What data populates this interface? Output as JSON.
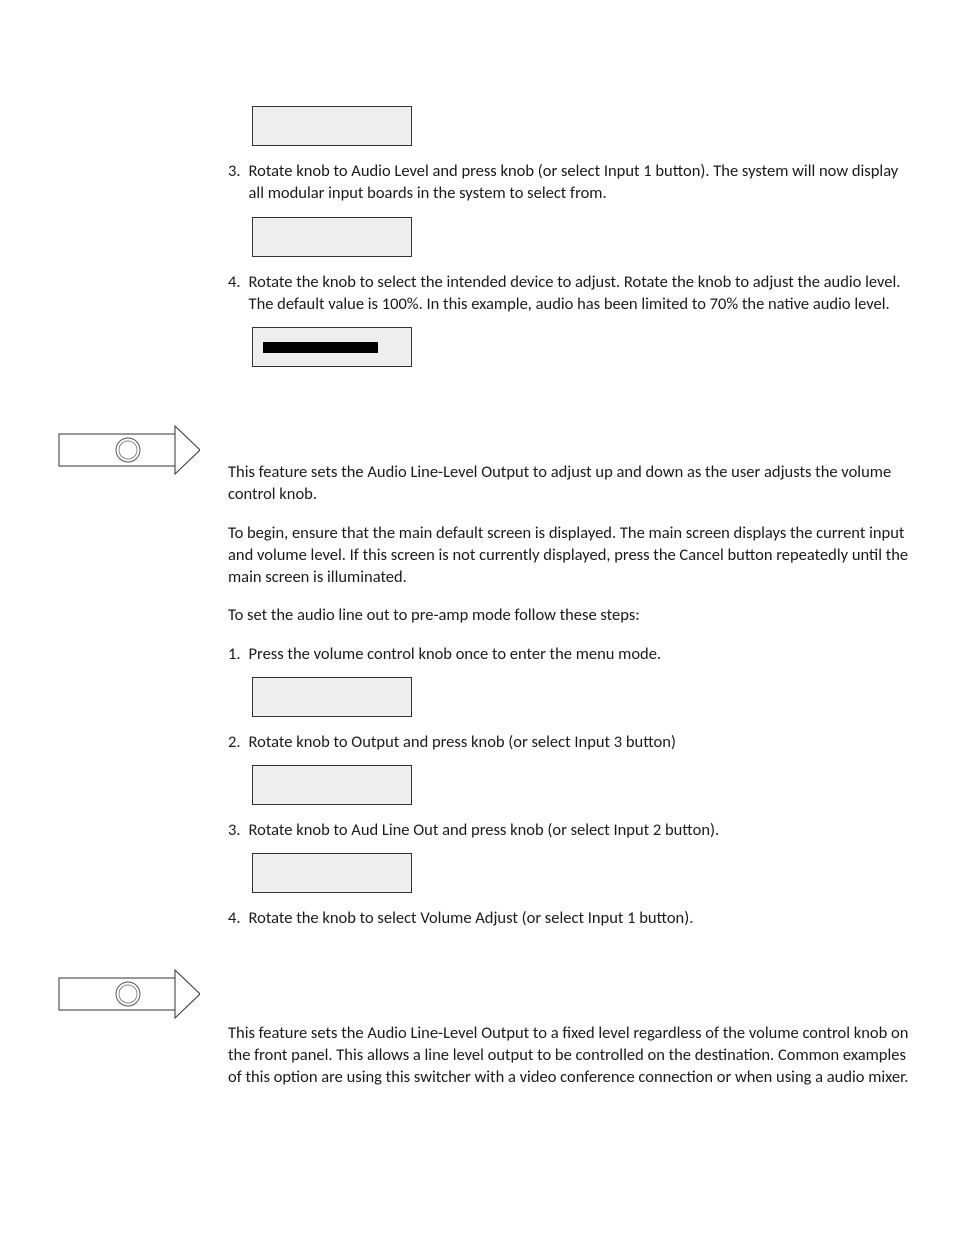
{
  "steps_a": [
    {
      "num": "3.",
      "text": "Rotate knob to Audio Level and press knob (or select Input 1 button). The system will now display all modular input boards in the system to select from."
    },
    {
      "num": "4.",
      "text": "Rotate the knob to select the intended device to adjust.  Rotate the knob to adjust the audio level. The default value is 100%. In this example, audio has been limited to 70% the native audio level."
    }
  ],
  "section_b": {
    "p1": "This feature sets the Audio Line-Level Output to adjust up and down as the user adjusts the volume control knob.",
    "p2": "To begin, ensure that the main default screen is displayed. The main screen displays the current input and volume level. If this screen is not currently displayed, press the Cancel button repeatedly until the main screen is illuminated.",
    "p3": "To set the audio line out to pre-amp mode follow these steps:",
    "steps": [
      {
        "num": "1.",
        "text": "Press the volume control knob once to enter the menu mode."
      },
      {
        "num": "2.",
        "text": "Rotate knob to Output and press knob (or select Input 3 button)"
      },
      {
        "num": "3.",
        "text": "Rotate knob to Aud Line Out and press knob (or select Input 2 button)."
      },
      {
        "num": "4.",
        "text": "Rotate the knob to select Volume Adjust (or select Input 1 button)."
      }
    ]
  },
  "section_c": {
    "p1": "This feature sets the Audio Line-Level Output to a fixed level regardless of the volume control knob on the front panel. This allows a line level output to be controlled on the destination. Common examples of this option are using this switcher with a video conference connection or when using a audio mixer."
  }
}
